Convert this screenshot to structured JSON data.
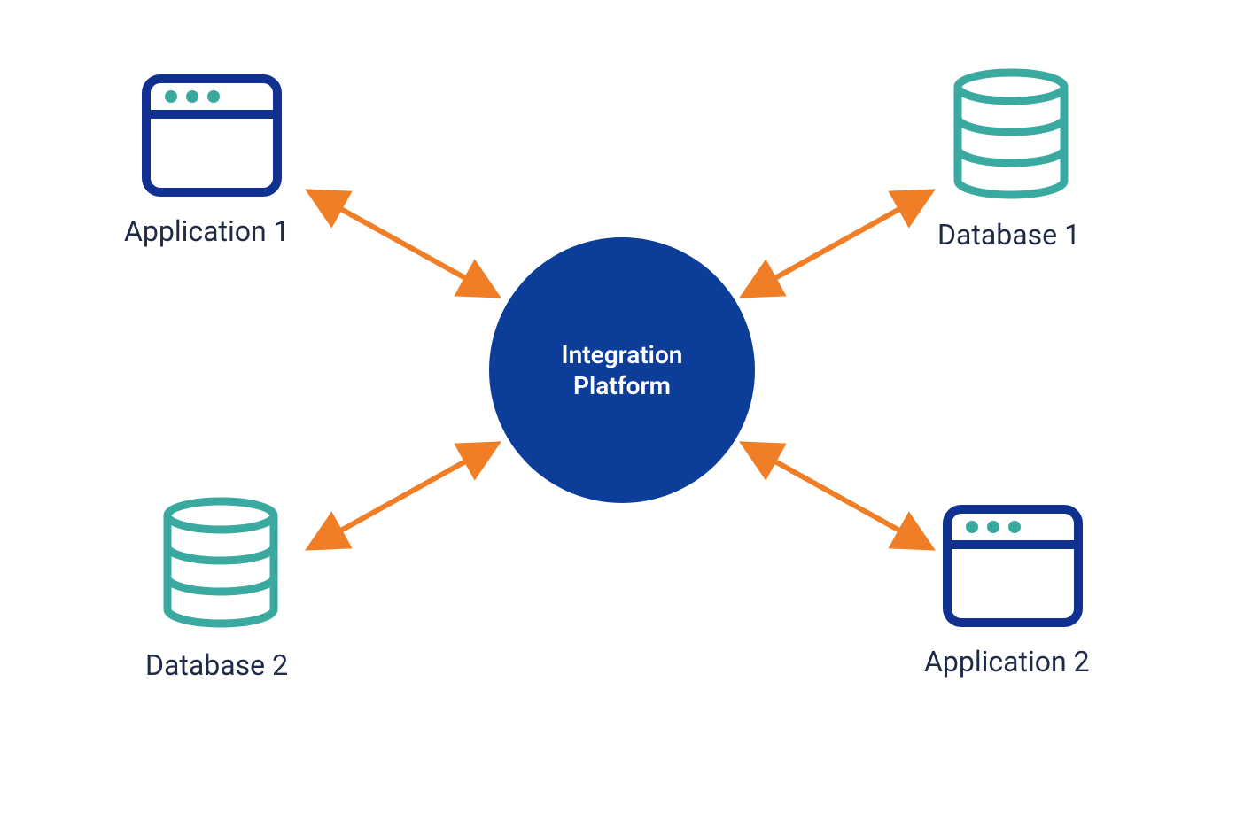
{
  "diagram": {
    "hub": {
      "label": "Integration\nPlatform"
    },
    "nodes": {
      "top_left": {
        "label": "Application 1",
        "type": "application"
      },
      "top_right": {
        "label": "Database 1",
        "type": "database"
      },
      "bottom_left": {
        "label": "Database 2",
        "type": "database"
      },
      "bottom_right": {
        "label": "Application 2",
        "type": "application"
      }
    },
    "colors": {
      "hub_fill": "#0c3e99",
      "app_stroke": "#10318f",
      "db_stroke": "#3aa99f",
      "dot_fill": "#3aa99f",
      "arrow": "#f07e26",
      "label": "#1f2a44"
    },
    "connectors": [
      {
        "from": "top_left",
        "to": "hub",
        "bidirectional": true
      },
      {
        "from": "top_right",
        "to": "hub",
        "bidirectional": true
      },
      {
        "from": "bottom_left",
        "to": "hub",
        "bidirectional": true
      },
      {
        "from": "bottom_right",
        "to": "hub",
        "bidirectional": true
      }
    ]
  }
}
